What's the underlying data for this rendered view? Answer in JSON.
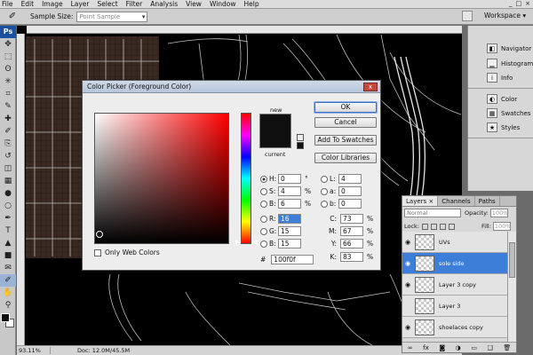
{
  "menu": [
    "File",
    "Edit",
    "Image",
    "Layer",
    "Select",
    "Filter",
    "Analysis",
    "View",
    "Window",
    "Help"
  ],
  "window_controls": [
    "_",
    "□",
    "×"
  ],
  "options_bar": {
    "sample_size_label": "Sample Size:",
    "sample_size_value": "Point Sample",
    "workspace_label": "Workspace ▾"
  },
  "tools": {
    "logo": "Ps",
    "icons": [
      "move-icon",
      "marquee-icon",
      "lasso-icon",
      "magic-wand-icon",
      "crop-icon",
      "eyedropper-icon",
      "healing-brush-icon",
      "brush-icon",
      "clone-stamp-icon",
      "history-brush-icon",
      "eraser-icon",
      "gradient-icon",
      "blur-icon",
      "dodge-icon",
      "pen-icon",
      "type-icon",
      "path-select-icon",
      "shape-icon",
      "notes-icon",
      "eyedropper-active-icon",
      "hand-icon",
      "zoom-icon"
    ],
    "glyphs": [
      "✥",
      "⬚",
      "ʘ",
      "✳",
      "⌗",
      "✎",
      "✚",
      "✐",
      "⎘",
      "↺",
      "◫",
      "▦",
      "●",
      "○",
      "✒",
      "T",
      "▲",
      "■",
      "✉",
      "✐",
      "✋",
      "⚲"
    ],
    "foreground_color": "#0f0f0f",
    "background_color": "#ffffff"
  },
  "status_bar": {
    "zoom": "93.11%",
    "doc": "Doc: 12.0M/45.5M"
  },
  "side_panels": [
    {
      "label": "Navigator",
      "icon": "navigator-icon",
      "glyph": "◧"
    },
    {
      "label": "Histogram",
      "icon": "histogram-icon",
      "glyph": "▁"
    },
    {
      "label": "Info",
      "icon": "info-icon",
      "glyph": "i"
    },
    {
      "label": "Color",
      "icon": "color-icon",
      "glyph": "◐"
    },
    {
      "label": "Swatches",
      "icon": "swatches-icon",
      "glyph": "▦"
    },
    {
      "label": "Styles",
      "icon": "styles-icon",
      "glyph": "★"
    }
  ],
  "layers_panel": {
    "tabs": [
      "Layers ×",
      "Channels",
      "Paths"
    ],
    "blend_mode": "Normal",
    "opacity_label": "Opacity:",
    "opacity_value": "100%",
    "lock_label": "Lock:",
    "fill_label": "Fill:",
    "fill_value": "100%",
    "layers": [
      {
        "name": "UVs",
        "visible": true,
        "selected": false
      },
      {
        "name": "sole side",
        "visible": true,
        "selected": true
      },
      {
        "name": "Layer 3 copy",
        "visible": true,
        "selected": false
      },
      {
        "name": "Layer 3",
        "visible": false,
        "selected": false
      },
      {
        "name": "shoelaces copy",
        "visible": true,
        "selected": false
      }
    ],
    "footer_icons": [
      "link-icon",
      "fx-icon",
      "mask-icon",
      "adjustment-icon",
      "group-icon",
      "new-layer-icon",
      "trash-icon"
    ],
    "footer_glyphs": [
      "∞",
      "fx",
      "◙",
      "◑",
      "▭",
      "❑",
      "🗑"
    ]
  },
  "color_picker": {
    "title": "Color Picker (Foreground Color)",
    "close": "x",
    "ok": "OK",
    "cancel": "Cancel",
    "add_to_swatches": "Add To Swatches",
    "color_libraries": "Color Libraries",
    "new_label": "new",
    "current_label": "current",
    "new_color": "#0f0f0f",
    "current_color": "#100f0f",
    "only_web_colors": "Only Web Colors",
    "hsb": [
      {
        "label": "H:",
        "value": "0",
        "unit": "°",
        "checked": true
      },
      {
        "label": "S:",
        "value": "4",
        "unit": "%",
        "checked": false
      },
      {
        "label": "B:",
        "value": "6",
        "unit": "%",
        "checked": false
      }
    ],
    "rgb": [
      {
        "label": "R:",
        "value": "16",
        "checked": false,
        "selected": true
      },
      {
        "label": "G:",
        "value": "15",
        "checked": false,
        "selected": false
      },
      {
        "label": "B:",
        "value": "15",
        "checked": false,
        "selected": false
      }
    ],
    "lab": [
      {
        "label": "L:",
        "value": "4",
        "checked": false
      },
      {
        "label": "a:",
        "value": "0",
        "checked": false
      },
      {
        "label": "b:",
        "value": "0",
        "checked": false
      }
    ],
    "cmyk": [
      {
        "label": "C:",
        "value": "73",
        "unit": "%"
      },
      {
        "label": "M:",
        "value": "67",
        "unit": "%"
      },
      {
        "label": "Y:",
        "value": "66",
        "unit": "%"
      },
      {
        "label": "K:",
        "value": "83",
        "unit": "%"
      }
    ],
    "hex_label": "#",
    "hex_value": "100f0f"
  }
}
